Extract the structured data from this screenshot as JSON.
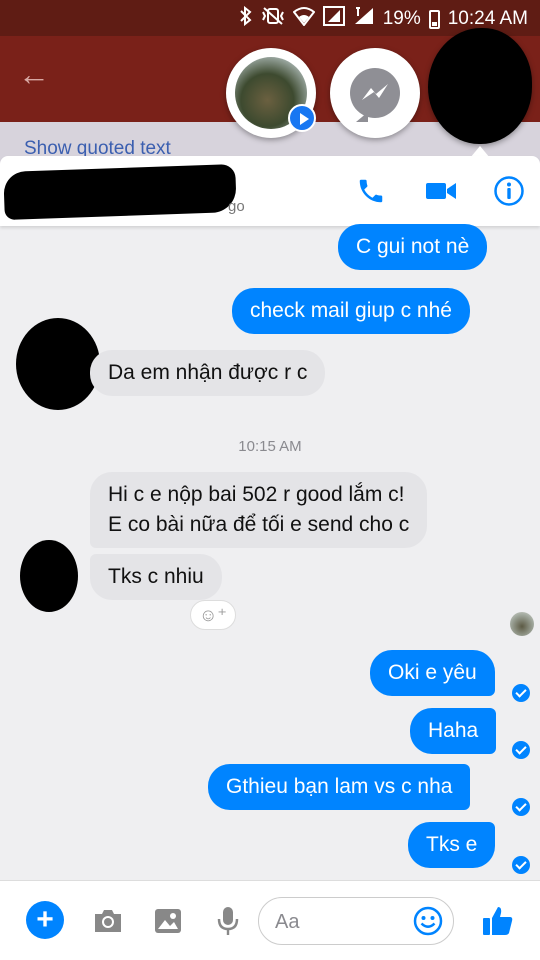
{
  "status_bar": {
    "battery": "19%",
    "time": "10:24 AM"
  },
  "background_app": {
    "quoted_link": "Show quoted text"
  },
  "header": {
    "active_suffix": "go"
  },
  "messages": {
    "m1": "C gui not nè",
    "m2": "check mail giup c nhé",
    "m3": "Da em nhận được r c",
    "timestamp": "10:15 AM",
    "m4_line1": "Hi c e nộp bai 502 r good lắm c!",
    "m4_line2": "E co bài nữa để tối e send cho c",
    "m5": "Tks c nhiu",
    "m6": "Oki e yêu",
    "m7": "Haha",
    "m8": "Gthieu bạn lam vs c nha",
    "m9": "Tks e"
  },
  "composer": {
    "placeholder": "Aa"
  },
  "icons": [
    "phone-icon",
    "video-icon",
    "info-icon",
    "plus-icon",
    "camera-icon",
    "image-icon",
    "microphone-icon",
    "emoji-icon",
    "like-icon"
  ],
  "colors": {
    "accent": "#0084ff",
    "incoming_bubble": "#e4e4e7",
    "mail_header": "#7a2119"
  }
}
